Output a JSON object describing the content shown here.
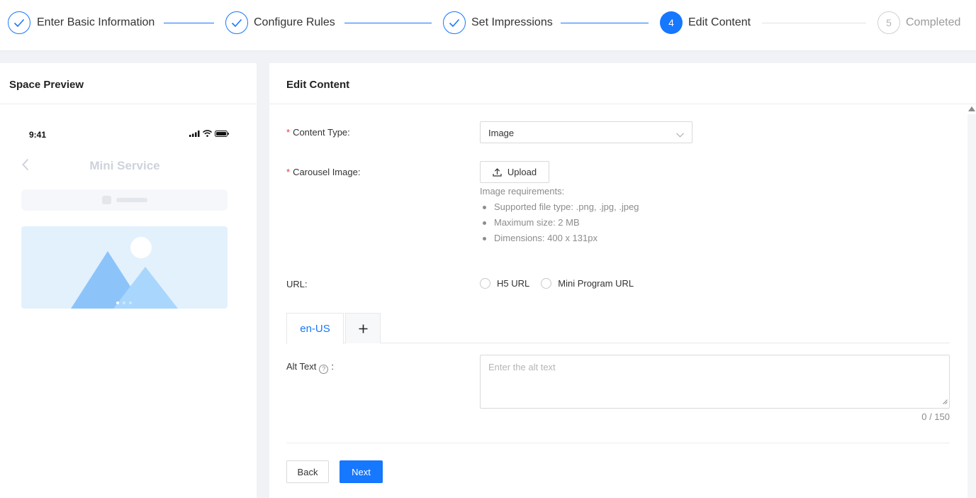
{
  "steps": [
    {
      "label": "Enter Basic Information",
      "status": "done"
    },
    {
      "label": "Configure Rules",
      "status": "done"
    },
    {
      "label": "Set Impressions",
      "status": "done"
    },
    {
      "label": "Edit Content",
      "status": "active",
      "number": "4"
    },
    {
      "label": "Completed",
      "status": "wait",
      "number": "5"
    }
  ],
  "preview": {
    "title": "Space Preview",
    "phone": {
      "time": "9:41",
      "page_title": "Mini Service",
      "icons": [
        "signal-icon",
        "wifi-icon",
        "battery-icon",
        "back-chevron-icon",
        "image-placeholder-icon"
      ]
    }
  },
  "form": {
    "title": "Edit Content",
    "content_type": {
      "label": "Content Type:",
      "value": "Image"
    },
    "carousel_image": {
      "label": "Carousel Image:",
      "upload_label": "Upload",
      "requirements_title": "Image requirements:",
      "requirements": [
        "Supported file type: .png, .jpg, .jpeg",
        "Maximum size: 2 MB",
        "Dimensions: 400 x 131px"
      ]
    },
    "url": {
      "label": "URL:",
      "options": [
        "H5 URL",
        "Mini Program URL"
      ]
    },
    "tabs": {
      "active": "en-US",
      "add": "+"
    },
    "alt_text": {
      "label": "Alt Text",
      "label_suffix": ":",
      "placeholder": "Enter the alt text",
      "counter": "0 / 150"
    },
    "buttons": {
      "back": "Back",
      "next": "Next"
    }
  },
  "colors": {
    "primary": "#1677ff",
    "required": "#e4393c"
  }
}
